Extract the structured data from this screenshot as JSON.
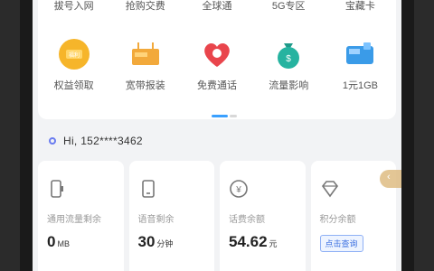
{
  "colors": {
    "accent": "#3aa0ff",
    "screen_bg": "#f2f3f5",
    "card_bg": "#ffffff"
  },
  "top_row": [
    "拔号入网",
    "抢购交费",
    "全球通",
    "5G专区",
    "宝藏卡"
  ],
  "entries": [
    {
      "label": "权益领取",
      "icon": "gift-icon"
    },
    {
      "label": "宽带报装",
      "icon": "broadband-icon"
    },
    {
      "label": "免费通话",
      "icon": "heart-call-icon"
    },
    {
      "label": "流量影响",
      "icon": "money-bag-icon"
    },
    {
      "label": "1元1GB",
      "icon": "data-card-icon"
    }
  ],
  "greeting": {
    "text": "Hi, 152****3462"
  },
  "balances": [
    {
      "label": "通用流量剩余",
      "value": "0",
      "unit": "MB",
      "icon": "data-icon"
    },
    {
      "label": "语音剩余",
      "value": "30",
      "unit": "分钟",
      "icon": "phone-icon"
    },
    {
      "label": "话费余额",
      "value": "54.62",
      "unit": "元",
      "icon": "yuan-icon"
    },
    {
      "label": "积分余额",
      "button": "点击查询",
      "icon": "diamond-icon"
    }
  ],
  "float_badge": "‹"
}
